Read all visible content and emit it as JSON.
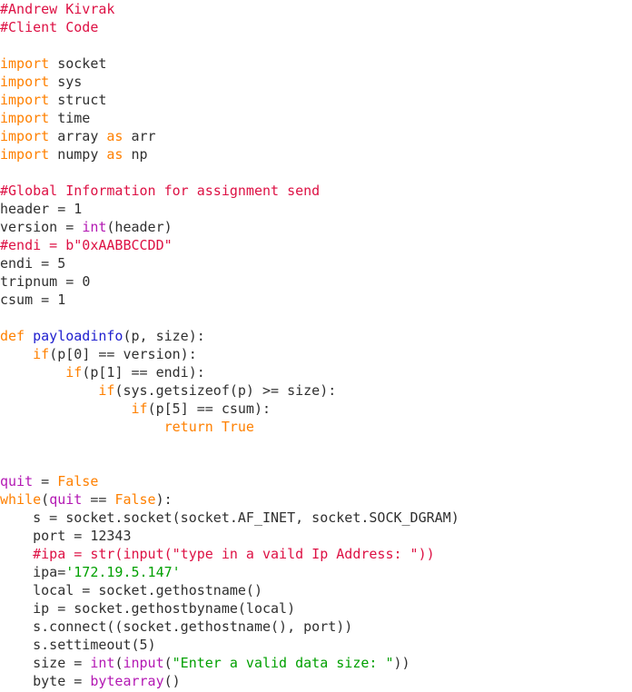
{
  "editor": {
    "language": "Python",
    "background": "#ffffff",
    "font_size_px": 15,
    "line_height_px": 20
  },
  "colors": {
    "plain": "#303030",
    "comment": "#dd1144",
    "keyword": "#ff8000",
    "builtin": "#b318b3",
    "funcname": "#2020cf",
    "string": "#00a000",
    "number": "#303030"
  },
  "code": {
    "lines": [
      {
        "tokens": [
          {
            "t": "comment",
            "v": "#Andrew Kivrak"
          }
        ]
      },
      {
        "tokens": [
          {
            "t": "comment",
            "v": "#Client Code"
          }
        ]
      },
      {
        "tokens": []
      },
      {
        "tokens": [
          {
            "t": "keyword",
            "v": "import"
          },
          {
            "t": "plain",
            "v": " socket"
          }
        ]
      },
      {
        "tokens": [
          {
            "t": "keyword",
            "v": "import"
          },
          {
            "t": "plain",
            "v": " sys"
          }
        ]
      },
      {
        "tokens": [
          {
            "t": "keyword",
            "v": "import"
          },
          {
            "t": "plain",
            "v": " struct"
          }
        ]
      },
      {
        "tokens": [
          {
            "t": "keyword",
            "v": "import"
          },
          {
            "t": "plain",
            "v": " time"
          }
        ]
      },
      {
        "tokens": [
          {
            "t": "keyword",
            "v": "import"
          },
          {
            "t": "plain",
            "v": " array "
          },
          {
            "t": "keyword",
            "v": "as"
          },
          {
            "t": "plain",
            "v": " arr"
          }
        ]
      },
      {
        "tokens": [
          {
            "t": "keyword",
            "v": "import"
          },
          {
            "t": "plain",
            "v": " numpy "
          },
          {
            "t": "keyword",
            "v": "as"
          },
          {
            "t": "plain",
            "v": " np"
          }
        ]
      },
      {
        "tokens": []
      },
      {
        "tokens": [
          {
            "t": "comment",
            "v": "#Global Information for assignment send"
          }
        ]
      },
      {
        "tokens": [
          {
            "t": "plain",
            "v": "header = "
          },
          {
            "t": "number",
            "v": "1"
          }
        ]
      },
      {
        "tokens": [
          {
            "t": "plain",
            "v": "version = "
          },
          {
            "t": "builtin",
            "v": "int"
          },
          {
            "t": "plain",
            "v": "(header)"
          }
        ]
      },
      {
        "tokens": [
          {
            "t": "comment",
            "v": "#endi = b\"0xAABBCCDD\""
          }
        ]
      },
      {
        "tokens": [
          {
            "t": "plain",
            "v": "endi = "
          },
          {
            "t": "number",
            "v": "5"
          }
        ]
      },
      {
        "tokens": [
          {
            "t": "plain",
            "v": "tripnum = "
          },
          {
            "t": "number",
            "v": "0"
          }
        ]
      },
      {
        "tokens": [
          {
            "t": "plain",
            "v": "csum = "
          },
          {
            "t": "number",
            "v": "1"
          }
        ]
      },
      {
        "tokens": []
      },
      {
        "tokens": [
          {
            "t": "keyword",
            "v": "def"
          },
          {
            "t": "plain",
            "v": " "
          },
          {
            "t": "funcname",
            "v": "payloadinfo"
          },
          {
            "t": "plain",
            "v": "(p, size):"
          }
        ]
      },
      {
        "tokens": [
          {
            "t": "plain",
            "v": "    "
          },
          {
            "t": "keyword",
            "v": "if"
          },
          {
            "t": "plain",
            "v": "(p["
          },
          {
            "t": "number",
            "v": "0"
          },
          {
            "t": "plain",
            "v": "] == version):"
          }
        ]
      },
      {
        "tokens": [
          {
            "t": "plain",
            "v": "        "
          },
          {
            "t": "keyword",
            "v": "if"
          },
          {
            "t": "plain",
            "v": "(p["
          },
          {
            "t": "number",
            "v": "1"
          },
          {
            "t": "plain",
            "v": "] == endi):"
          }
        ]
      },
      {
        "tokens": [
          {
            "t": "plain",
            "v": "            "
          },
          {
            "t": "keyword",
            "v": "if"
          },
          {
            "t": "plain",
            "v": "(sys.getsizeof(p) >= size):"
          }
        ]
      },
      {
        "tokens": [
          {
            "t": "plain",
            "v": "                "
          },
          {
            "t": "keyword",
            "v": "if"
          },
          {
            "t": "plain",
            "v": "(p["
          },
          {
            "t": "number",
            "v": "5"
          },
          {
            "t": "plain",
            "v": "] == csum):"
          }
        ]
      },
      {
        "tokens": [
          {
            "t": "plain",
            "v": "                    "
          },
          {
            "t": "keyword",
            "v": "return"
          },
          {
            "t": "plain",
            "v": " "
          },
          {
            "t": "keyword",
            "v": "True"
          }
        ]
      },
      {
        "tokens": []
      },
      {
        "tokens": []
      },
      {
        "tokens": [
          {
            "t": "builtin",
            "v": "quit"
          },
          {
            "t": "plain",
            "v": " = "
          },
          {
            "t": "keyword",
            "v": "False"
          }
        ]
      },
      {
        "tokens": [
          {
            "t": "keyword",
            "v": "while"
          },
          {
            "t": "plain",
            "v": "("
          },
          {
            "t": "builtin",
            "v": "quit"
          },
          {
            "t": "plain",
            "v": " == "
          },
          {
            "t": "keyword",
            "v": "False"
          },
          {
            "t": "plain",
            "v": "):"
          }
        ]
      },
      {
        "tokens": [
          {
            "t": "plain",
            "v": "    s = socket.socket(socket.AF_INET, socket.SOCK_DGRAM)"
          }
        ]
      },
      {
        "tokens": [
          {
            "t": "plain",
            "v": "    port = "
          },
          {
            "t": "number",
            "v": "12343"
          }
        ]
      },
      {
        "tokens": [
          {
            "t": "plain",
            "v": "    "
          },
          {
            "t": "comment",
            "v": "#ipa = str(input(\"type in a vaild Ip Address: \"))"
          }
        ]
      },
      {
        "tokens": [
          {
            "t": "plain",
            "v": "    ipa="
          },
          {
            "t": "string",
            "v": "'172.19.5.147'"
          }
        ]
      },
      {
        "tokens": [
          {
            "t": "plain",
            "v": "    local = socket.gethostname()"
          }
        ]
      },
      {
        "tokens": [
          {
            "t": "plain",
            "v": "    ip = socket.gethostbyname(local)"
          }
        ]
      },
      {
        "tokens": [
          {
            "t": "plain",
            "v": "    s.connect((socket.gethostname(), port))"
          }
        ]
      },
      {
        "tokens": [
          {
            "t": "plain",
            "v": "    s.settimeout("
          },
          {
            "t": "number",
            "v": "5"
          },
          {
            "t": "plain",
            "v": ")"
          }
        ]
      },
      {
        "tokens": [
          {
            "t": "plain",
            "v": "    size = "
          },
          {
            "t": "builtin",
            "v": "int"
          },
          {
            "t": "plain",
            "v": "("
          },
          {
            "t": "builtin",
            "v": "input"
          },
          {
            "t": "plain",
            "v": "("
          },
          {
            "t": "string",
            "v": "\"Enter a valid data size: \""
          },
          {
            "t": "plain",
            "v": "))"
          }
        ]
      },
      {
        "tokens": [
          {
            "t": "plain",
            "v": "    byte = "
          },
          {
            "t": "builtin",
            "v": "bytearray"
          },
          {
            "t": "plain",
            "v": "()"
          }
        ]
      }
    ]
  }
}
